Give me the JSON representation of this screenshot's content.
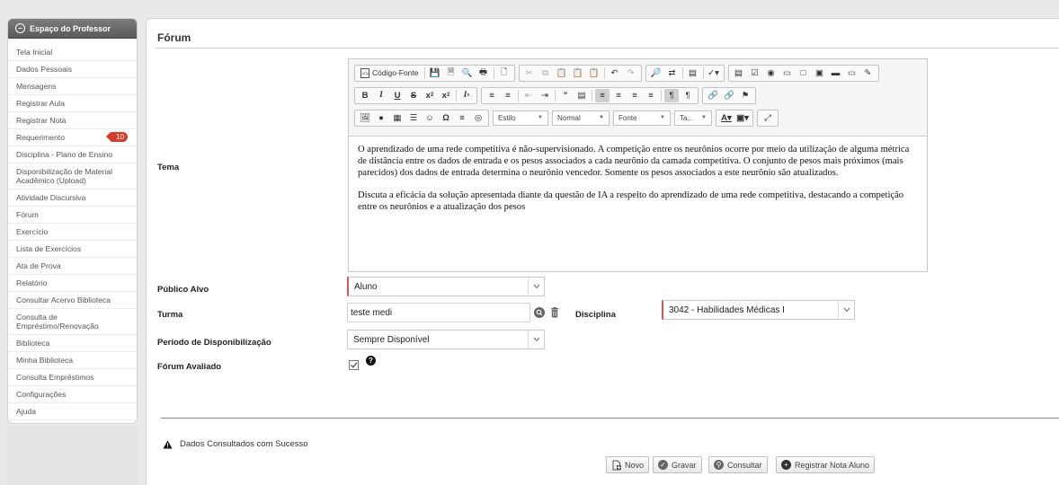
{
  "sidebar": {
    "header": "Espaço do Professor",
    "items": [
      {
        "label": "Tela Inicial"
      },
      {
        "label": "Dados Pessoais"
      },
      {
        "label": "Mensagens"
      },
      {
        "label": "Registrar Aula"
      },
      {
        "label": "Registrar Nota"
      },
      {
        "label": "Requerimento",
        "badge": "10"
      },
      {
        "label": "Disciplina - Plano de Ensino"
      },
      {
        "label": "Disponibilização de Material Acadêmico (Upload)"
      },
      {
        "label": "Atividade Discursiva"
      },
      {
        "label": "Fórum"
      },
      {
        "label": "Exercício"
      },
      {
        "label": "Lista de Exercícios"
      },
      {
        "label": "Ata de Prova"
      },
      {
        "label": "Relatório"
      },
      {
        "label": "Consultar Acervo Biblioteca"
      },
      {
        "label": "Consulta de Empréstimo/Renovação"
      },
      {
        "label": "Biblioteca"
      },
      {
        "label": "Minha Biblioteca"
      },
      {
        "label": "Consulta Empréstimos"
      },
      {
        "label": "Configurações"
      },
      {
        "label": "Ajuda"
      }
    ]
  },
  "page": {
    "title": "Fórum"
  },
  "form": {
    "tema_label": "Tema",
    "publico_label": "Público Alvo",
    "publico_value": "Aluno",
    "turma_label": "Turma",
    "turma_value": "teste medi",
    "disciplina_label": "Disciplina",
    "disciplina_value": "3042 - Habilidades Médicas I",
    "periodo_label": "Período de Disponibilização",
    "periodo_value": "Sempre Disponível",
    "avaliado_label": "Fórum Avaliado",
    "avaliado_checked": true
  },
  "editor": {
    "toolbar": {
      "source_label": "Código-Fonte",
      "estilo": "Estilo",
      "normal": "Normal",
      "fonte": "Fonte",
      "tamanho": "Ta..."
    },
    "paragraphs": [
      "O aprendizado de uma rede competitiva é não-supervisionado. A competição entre os neurônios ocorre por meio da utilização de alguma métrica de distância entre os dados de entrada e os pesos associados a cada neurônio da camada competitiva. O conjunto de pesos mais próximos (mais parecidos) dos dados de entrada determina o neurônio vencedor. Somente os pesos associados a este neurônio são atualizados.",
      "Discuta a eficácia da solução apresentada diante da questão de IA a respeito do aprendizado de uma rede competitiva, destacando a competição entre os neurônios e a atualização dos pesos"
    ]
  },
  "status": {
    "message": "Dados Consultados com Sucesso"
  },
  "buttons": {
    "novo": "Novo",
    "gravar": "Gravar",
    "consultar": "Consultar",
    "registrar": "Registrar Nota Aluno"
  },
  "colors": {
    "badge": "#d43c2c",
    "required_border": "#d95757",
    "header_bg": "#6a6a6a"
  }
}
